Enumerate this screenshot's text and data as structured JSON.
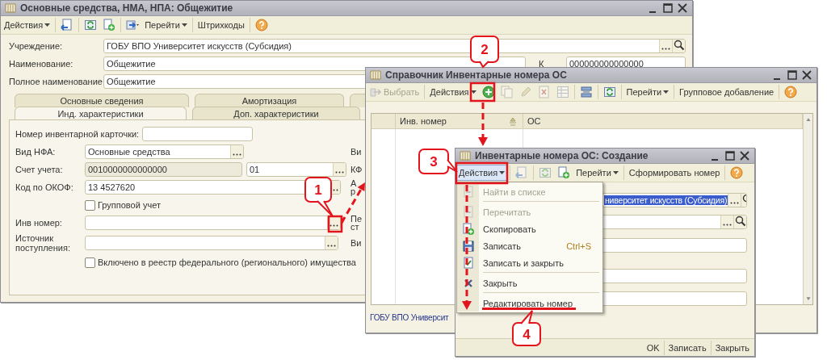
{
  "main_window": {
    "title": "Основные средства, НМА, НПА: Общежитие",
    "toolbar": [
      {
        "kind": "menu",
        "label": "Действия"
      },
      {
        "kind": "menu",
        "label": "Перейти"
      },
      {
        "kind": "button",
        "label": "Штрихкоды"
      }
    ],
    "header_fields": [
      {
        "label": "Учреждение:",
        "value": "ГОБУ ВПО Университет искусств (Субсидия)"
      },
      {
        "label": "Наименование:",
        "value": "Общежитие"
      },
      {
        "label": "Полное наименование:",
        "value": "Общежитие"
      }
    ],
    "side_field": {
      "label": "К",
      "value": "000000000000000"
    },
    "tabs_top": [
      {
        "label": "Основные сведения",
        "selected": false
      },
      {
        "label": "Амортизация",
        "selected": false
      }
    ],
    "tabs_bottom": [
      {
        "label": "Инд. характеристики",
        "selected": true
      },
      {
        "label": "Доп. характеристики",
        "selected": false
      }
    ],
    "fields": [
      {
        "kind": "text",
        "label": "Номер инвентарной карточки:"
      },
      {
        "kind": "select",
        "label": "Вид НФА:",
        "value": "Основные средства",
        "side_label": "Ви"
      },
      {
        "kind": "account",
        "label": "Счет учета:",
        "value": "0010000000000000",
        "value_2": "01",
        "side_label": "КФ"
      },
      {
        "kind": "select",
        "label": "Код по ОКОФ:",
        "value": "13 4527620",
        "side_label": "А р"
      },
      {
        "kind": "checkbox",
        "label": "Групповой учет",
        "checked": false
      },
      {
        "kind": "select",
        "label": "Инв номер:",
        "side_label": "Пе ст"
      },
      {
        "kind": "select",
        "label": "Источник поступления:",
        "side_label": "Ви"
      },
      {
        "kind": "checkbox",
        "label": "Включено в реестр федерального (регионального) имущества",
        "checked": false
      }
    ]
  },
  "list_window": {
    "title": "Справочник Инвентарные номера ОС",
    "toolbar": [
      {
        "kind": "button",
        "label": "Выбрать",
        "disabled": true
      },
      {
        "kind": "menu",
        "label": "Действия",
        "disabled": false
      },
      {
        "kind": "menu",
        "label": "Перейти",
        "disabled": false
      },
      {
        "kind": "button",
        "label": "Групповое добавление",
        "disabled": false
      }
    ],
    "columns": [
      "Инв. номер",
      "ОС"
    ],
    "footer": "ГОБУ ВПО Университ"
  },
  "create_window": {
    "title": "Инвентарные номера ОС: Создание",
    "toolbar": [
      {
        "kind": "menu",
        "label": "Действия",
        "pressed": true
      },
      {
        "kind": "menu",
        "label": "Перейти",
        "pressed": false
      },
      {
        "kind": "button",
        "label": "Сформировать номер",
        "pressed": false
      }
    ],
    "fields": [
      {
        "kind": "reference",
        "value": "ниверситет искусств (Субсидия)",
        "highlighted": true
      },
      {
        "kind": "reference"
      },
      {
        "kind": "text"
      },
      {
        "kind": "text"
      },
      {
        "kind": "text"
      }
    ],
    "buttons": [
      "OK",
      "Записать",
      "Закрыть"
    ]
  },
  "actions_menu": {
    "items": [
      {
        "kind": "item",
        "label": "Найти в списке",
        "disabled": true
      },
      {
        "kind": "separator"
      },
      {
        "kind": "item",
        "label": "Перечитать",
        "disabled": true
      },
      {
        "kind": "item",
        "label": "Скопировать",
        "disabled": false
      },
      {
        "kind": "item",
        "label": "Записать",
        "shortcut": "Ctrl+S",
        "disabled": false
      },
      {
        "kind": "item",
        "label": "Записать и закрыть",
        "disabled": false
      },
      {
        "kind": "separator"
      },
      {
        "kind": "item",
        "label": "Закрыть",
        "disabled": false
      },
      {
        "kind": "separator"
      },
      {
        "kind": "item",
        "label": "Редактировать номер",
        "disabled": false
      }
    ]
  },
  "callouts": [
    {
      "label": "1"
    },
    {
      "label": "2"
    },
    {
      "label": "3"
    },
    {
      "label": "4"
    }
  ]
}
